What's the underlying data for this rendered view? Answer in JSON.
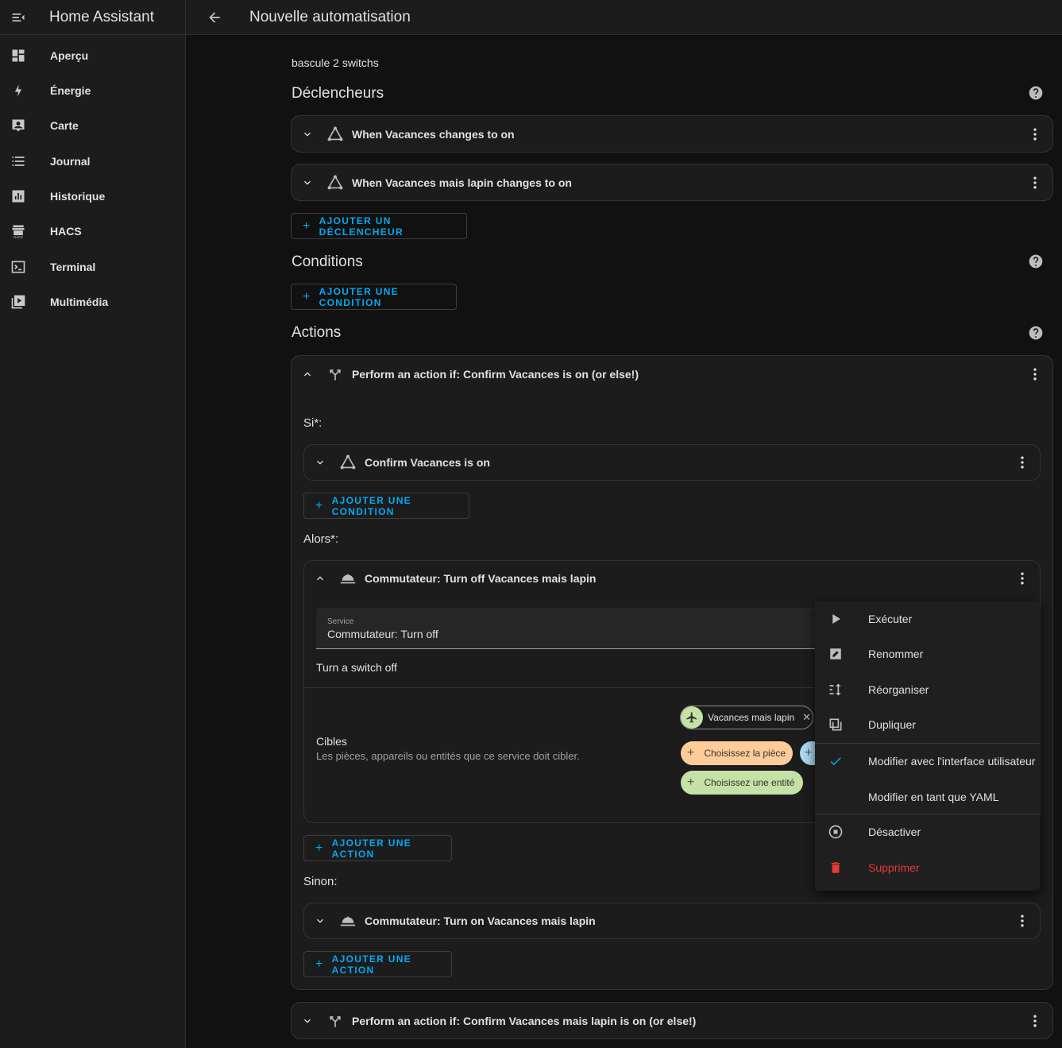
{
  "sidebar": {
    "title": "Home Assistant",
    "items": [
      {
        "label": "Aperçu",
        "icon": "dashboard-icon"
      },
      {
        "label": "Énergie",
        "icon": "lightning-icon"
      },
      {
        "label": "Carte",
        "icon": "map-person-icon"
      },
      {
        "label": "Journal",
        "icon": "list-icon"
      },
      {
        "label": "Historique",
        "icon": "chart-bar-icon"
      },
      {
        "label": "HACS",
        "icon": "hacs-icon"
      },
      {
        "label": "Terminal",
        "icon": "terminal-icon"
      },
      {
        "label": "Multimédia",
        "icon": "media-icon"
      }
    ]
  },
  "topbar": {
    "title": "Nouvelle automatisation"
  },
  "automation": {
    "name": "bascule 2 switchs"
  },
  "triggers": {
    "title": "Déclencheurs",
    "items": [
      {
        "label": "When Vacances changes to on"
      },
      {
        "label": "When Vacances mais lapin changes to on"
      }
    ],
    "add_label": "AJOUTER UN DÉCLENCHEUR"
  },
  "conditions": {
    "title": "Conditions",
    "add_label": "AJOUTER UNE CONDITION"
  },
  "actions": {
    "title": "Actions",
    "action1": {
      "label": "Perform an action if: Confirm Vacances is on (or else!)",
      "if_label": "Si*:",
      "if_condition": "Confirm Vacances is on",
      "add_condition": "AJOUTER UNE CONDITION",
      "then_label": "Alors*:",
      "then_action": {
        "label": "Commutateur: Turn off Vacances mais lapin",
        "service_label": "Service",
        "service_value": "Commutateur: Turn off",
        "description": "Turn a switch off",
        "targets_title": "Cibles",
        "targets_desc": "Les pièces, appareils ou entités que ce service doit cibler.",
        "chip_entity": "Vacances mais lapin",
        "chip_room": "Choisissez la pièce",
        "chip_choose_entity": "Choisissez une entité"
      },
      "add_action": "AJOUTER UNE ACTION",
      "else_label": "Sinon:",
      "else_action": "Commutateur: Turn on Vacances mais lapin",
      "add_action2": "AJOUTER UNE ACTION"
    },
    "action2": {
      "label": "Perform an action if: Confirm Vacances mais lapin is on (or else!)"
    }
  },
  "menu": {
    "items": [
      {
        "label": "Exécuter"
      },
      {
        "label": "Renommer"
      },
      {
        "label": "Réorganiser"
      },
      {
        "label": "Dupliquer"
      },
      {
        "label": "Modifier avec l'interface utilisateur"
      },
      {
        "label": "Modifier en tant que YAML"
      },
      {
        "label": "Désactiver"
      },
      {
        "label": "Supprimer"
      }
    ],
    "danger_color": "#e53935"
  },
  "colors": {
    "accent": "#03a9f4",
    "card": "#1c1c1c",
    "background": "#111111"
  }
}
